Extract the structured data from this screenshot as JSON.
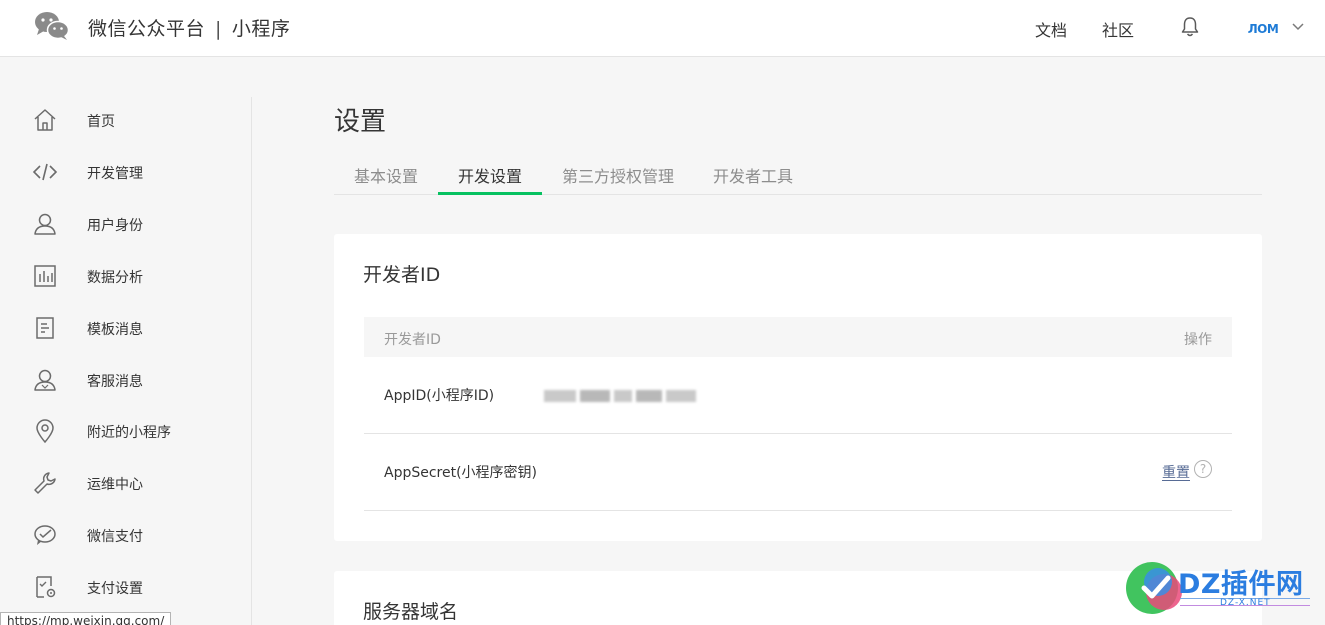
{
  "header": {
    "brand_left": "微信公众平台",
    "brand_sep": "|",
    "brand_right": "小程序",
    "links": {
      "docs": "文档",
      "community": "社区"
    },
    "avatar_text": "ЛОМ"
  },
  "sidebar": {
    "items": [
      {
        "label": "首页",
        "icon": "home-icon"
      },
      {
        "label": "开发管理",
        "icon": "code-icon"
      },
      {
        "label": "用户身份",
        "icon": "user-icon"
      },
      {
        "label": "数据分析",
        "icon": "bar-chart-icon"
      },
      {
        "label": "模板消息",
        "icon": "document-icon"
      },
      {
        "label": "客服消息",
        "icon": "customer-service-icon"
      },
      {
        "label": "附近的小程序",
        "icon": "location-pin-icon"
      },
      {
        "label": "运维中心",
        "icon": "wrench-icon"
      },
      {
        "label": "微信支付",
        "icon": "wechat-pay-icon"
      },
      {
        "label": "支付设置",
        "icon": "payment-settings-icon"
      }
    ]
  },
  "main": {
    "title": "设置",
    "tabs": [
      {
        "label": "基本设置",
        "active": false
      },
      {
        "label": "开发设置",
        "active": true
      },
      {
        "label": "第三方授权管理",
        "active": false
      },
      {
        "label": "开发者工具",
        "active": false
      }
    ],
    "developer_card": {
      "title": "开发者ID",
      "columns": {
        "id": "开发者ID",
        "action": "操作"
      },
      "rows": [
        {
          "name": "AppID(小程序ID)",
          "value_redacted": true
        },
        {
          "name": "AppSecret(小程序密钥)",
          "action": "重置",
          "help": "?"
        }
      ]
    },
    "server_card": {
      "title": "服务器域名"
    }
  },
  "statusbar": {
    "url": "https://mp.weixin.qq.com/"
  },
  "watermark": {
    "text": "DZ插件网",
    "sub": "DZ-X.NET"
  },
  "colors": {
    "accent": "#07c160",
    "link": "#576b95",
    "background": "#f6f6f6"
  }
}
